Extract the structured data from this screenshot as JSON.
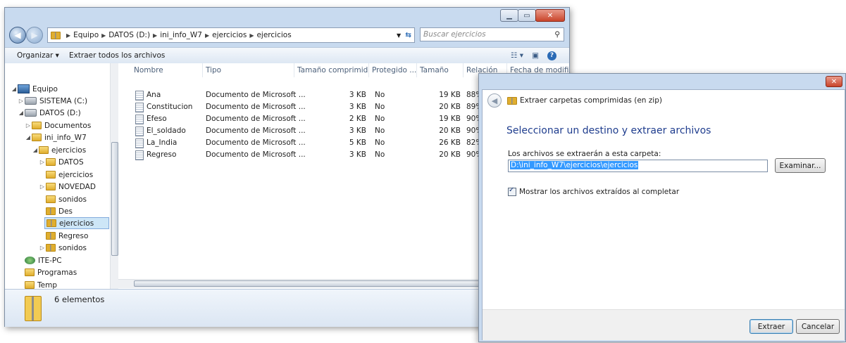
{
  "explorer": {
    "breadcrumb": [
      "Equipo",
      "DATOS (D:)",
      "ini_info_W7",
      "ejercicios",
      "ejercicios"
    ],
    "search_placeholder": "Buscar ejercicios",
    "toolbar": {
      "organize": "Organizar ▾",
      "extract_all": "Extraer todos los archivos"
    },
    "tree": {
      "equipo": "Equipo",
      "sistema": "SISTEMA (C:)",
      "datos_drive": "DATOS (D:)",
      "documentos": "Documentos",
      "ini_info": "ini_info_W7",
      "ejercicios": "ejercicios",
      "datos": "DATOS",
      "ejercicios2": "ejercicios",
      "novedad": "NOVEDAD",
      "sonidos": "sonidos",
      "des": "Des",
      "ejercicios_zip": "ejercicios",
      "regreso": "Regreso",
      "sonidos2": "sonidos",
      "ite_pc": "ITE-PC",
      "programas": "Programas",
      "temp": "Temp"
    },
    "columns": {
      "nombre": "Nombre",
      "tipo": "Tipo",
      "tamano_comprimido": "Tamaño comprimido",
      "protegido": "Protegido ...",
      "tamano": "Tamaño",
      "relacion": "Relación",
      "fecha": "Fecha de modific"
    },
    "files": [
      {
        "nombre": "Ana",
        "tipo": "Documento de Microsoft ...",
        "comp": "3 KB",
        "prot": "No",
        "tam": "19 KB",
        "rel": "88%"
      },
      {
        "nombre": "Constitucion",
        "tipo": "Documento de Microsoft ...",
        "comp": "3 KB",
        "prot": "No",
        "tam": "20 KB",
        "rel": "89%"
      },
      {
        "nombre": "Efeso",
        "tipo": "Documento de Microsoft ...",
        "comp": "2 KB",
        "prot": "No",
        "tam": "19 KB",
        "rel": "90%"
      },
      {
        "nombre": "El_soldado",
        "tipo": "Documento de Microsoft ...",
        "comp": "3 KB",
        "prot": "No",
        "tam": "20 KB",
        "rel": "90%"
      },
      {
        "nombre": "La_India",
        "tipo": "Documento de Microsoft ...",
        "comp": "5 KB",
        "prot": "No",
        "tam": "26 KB",
        "rel": "82%"
      },
      {
        "nombre": "Regreso",
        "tipo": "Documento de Microsoft ...",
        "comp": "3 KB",
        "prot": "No",
        "tam": "20 KB",
        "rel": "90%"
      }
    ],
    "status": "6 elementos"
  },
  "dialog": {
    "title": "Extraer carpetas comprimidas (en zip)",
    "heading": "Seleccionar un destino y extraer archivos",
    "label": "Los archivos se extraerán a esta carpeta:",
    "path": "D:\\ini_info_W7\\ejercicios\\ejercicios",
    "browse": "Examinar...",
    "checkbox": "Mostrar los archivos extraídos al completar",
    "extract": "Extraer",
    "cancel": "Cancelar"
  }
}
